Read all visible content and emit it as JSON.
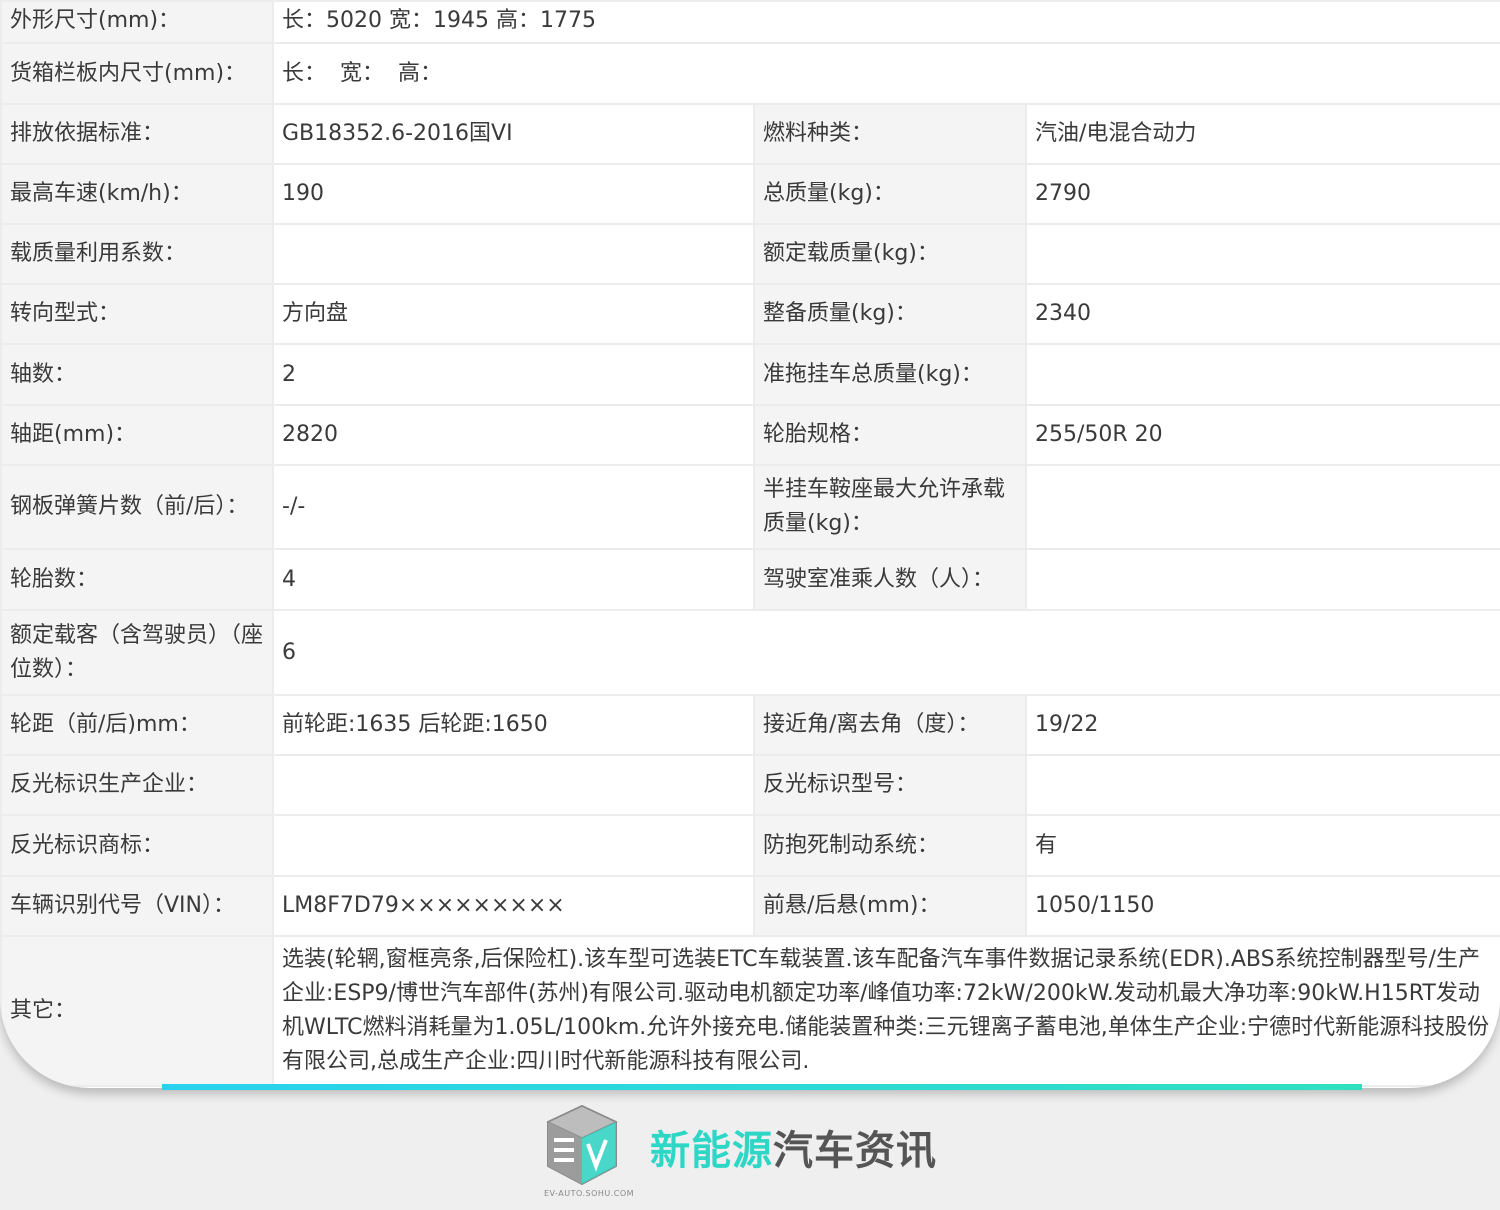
{
  "spec": {
    "dimensions_label": "外形尺寸(mm)：",
    "dimensions_value": "长：5020 宽：1945 高：1775",
    "cargo_box_label": "货箱栏板内尺寸(mm)：",
    "cargo_box_value": "长：  宽：  高：",
    "emission_label": "排放依据标准：",
    "emission_value": "GB18352.6-2016国VI",
    "fuel_label": "燃料种类：",
    "fuel_value": "汽油/电混合动力",
    "max_speed_label": "最高车速(km/h)：",
    "max_speed_value": "190",
    "total_mass_label": "总质量(kg)：",
    "total_mass_value": "2790",
    "load_coef_label": "载质量利用系数：",
    "load_coef_value": "",
    "rated_load_label": "额定载质量(kg)：",
    "rated_load_value": "",
    "steering_label": "转向型式：",
    "steering_value": "方向盘",
    "curb_mass_label": "整备质量(kg)：",
    "curb_mass_value": "2340",
    "axles_label": "轴数：",
    "axles_value": "2",
    "trailer_mass_label": "准拖挂车总质量(kg)：",
    "trailer_mass_value": "",
    "wheelbase_label": "轴距(mm)：",
    "wheelbase_value": "2820",
    "tire_spec_label": "轮胎规格：",
    "tire_spec_value": "255/50R 20",
    "leaf_spring_label": "钢板弹簧片数（前/后）：",
    "leaf_spring_value": "-/-",
    "saddle_label": "半挂车鞍座最大允许承载质量(kg)：",
    "saddle_value": "",
    "tire_count_label": "轮胎数：",
    "tire_count_value": "4",
    "cab_passengers_label": "驾驶室准乘人数（人）：",
    "cab_passengers_value": "",
    "seats_label": "额定载客（含驾驶员）（座位数）：",
    "seats_value": "6",
    "track_label": "轮距（前/后)mm：",
    "track_value": "前轮距:1635 后轮距:1650",
    "angles_label": "接近角/离去角（度）：",
    "angles_value": "19/22",
    "reflector_maker_label": "反光标识生产企业：",
    "reflector_maker_value": "",
    "reflector_model_label": "反光标识型号：",
    "reflector_model_value": "",
    "reflector_brand_label": "反光标识商标：",
    "reflector_brand_value": "",
    "abs_label": "防抱死制动系统：",
    "abs_value": "有",
    "vin_label": "车辆识别代号（VIN）：",
    "vin_value": "LM8F7D79×××××××××",
    "overhang_label": "前悬/后悬(mm)：",
    "overhang_value": "1050/1150",
    "other_label": "其它：",
    "other_value": "选装(轮辋,窗框亮条,后保险杠).该车型可选装ETC车载装置.该车配备汽车事件数据记录系统(EDR).ABS系统控制器型号/生产企业:ESP9/博世汽车部件(苏州)有限公司.驱动电机额定功率/峰值功率:72kW/200kW.发动机最大净功率:90kW.H15RT发动机WLTC燃料消耗量为1.05L/100km.允许外接充电.储能装置种类:三元锂离子蓄电池,单体生产企业:宁德时代新能源科技股份有限公司,总成生产企业:四川时代新能源科技有限公司."
  },
  "brand": {
    "text_accent": "新能源",
    "text_main": "汽车资讯",
    "url": "EV-AUTO.SOHU.COM",
    "accent_color": "#2ed6c6",
    "text_color": "#555555"
  }
}
